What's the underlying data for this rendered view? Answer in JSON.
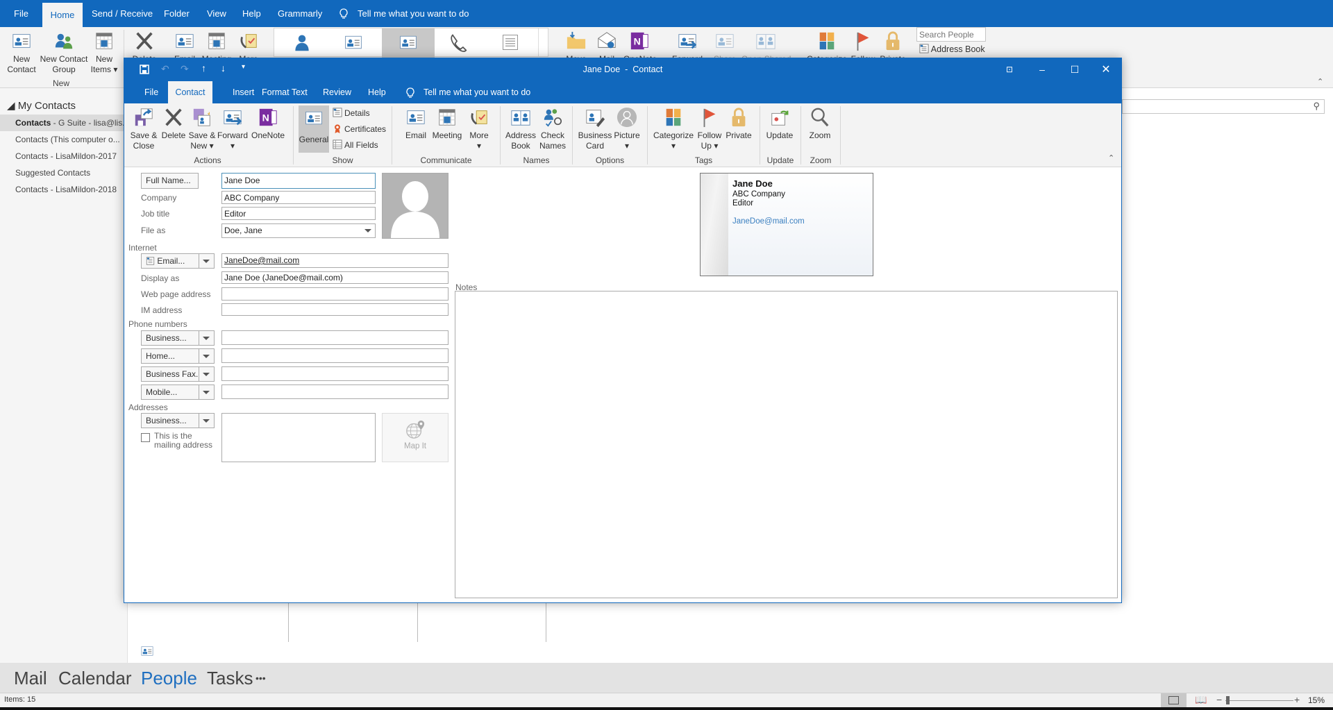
{
  "main": {
    "tabs": [
      {
        "label": "File"
      },
      {
        "label": "Home",
        "active": true
      },
      {
        "label": "Send / Receive"
      },
      {
        "label": "Folder"
      },
      {
        "label": "View"
      },
      {
        "label": "Help"
      },
      {
        "label": "Grammarly"
      }
    ],
    "tell_me": "Tell me what you want to do",
    "ribbon": {
      "new_contact": "New\nContact",
      "new_contact_group": "New Contact\nGroup",
      "new_items": "New\nItems ▾",
      "group_new": "New",
      "delete": "Delete",
      "email": "Email",
      "meeting": "Meeting",
      "more": "More",
      "move": "Move",
      "mail": "Mail",
      "onenote": "OneNote",
      "forward": "Forward",
      "share": "Share",
      "open_shared": "Open Shared",
      "categorize": "Categorize",
      "follow": "Follow",
      "private": "Private",
      "search_people_placeholder": "Search People",
      "address_book": "Address Book"
    },
    "accent_color": "#1168bd"
  },
  "sidebar": {
    "header": "My Contacts",
    "items": [
      {
        "bold": "Contacts",
        "rest": " - G Suite - lisa@lis...",
        "selected": true
      },
      {
        "bold": "",
        "rest": "Contacts (This computer o..."
      },
      {
        "bold": "",
        "rest": "Contacts - LisaMildon-2017"
      },
      {
        "bold": "",
        "rest": "Suggested Contacts"
      },
      {
        "bold": "",
        "rest": "Contacts - LisaMildon-2018"
      }
    ]
  },
  "nav": {
    "items": [
      "Mail",
      "Calendar",
      "People",
      "Tasks"
    ],
    "active": "People",
    "more": "•••"
  },
  "status": {
    "items": "Items: 15",
    "zoom": "15%",
    "zoom_value": 15
  },
  "window": {
    "title": "Jane Doe  -  Contact",
    "tabs": [
      {
        "label": "File"
      },
      {
        "label": "Contact",
        "active": true
      },
      {
        "label": "Insert"
      },
      {
        "label": "Format Text"
      },
      {
        "label": "Review"
      },
      {
        "label": "Help"
      }
    ],
    "tell_me": "Tell me what you want to do",
    "ribbon": {
      "save_close": "Save &\nClose",
      "delete": "Delete",
      "save_new": "Save &\nNew ▾",
      "forward": "Forward\n▾",
      "onenote": "OneNote",
      "general": "General",
      "details": "Details",
      "certificates": "Certificates",
      "all_fields": "All Fields",
      "email": "Email",
      "meeting": "Meeting",
      "more": "More\n▾",
      "address_book": "Address\nBook",
      "check_names": "Check\nNames",
      "business_card": "Business\nCard",
      "picture": "Picture\n▾",
      "categorize": "Categorize\n▾",
      "follow_up": "Follow\nUp ▾",
      "private": "Private",
      "update": "Update",
      "zoom": "Zoom",
      "groups": {
        "actions": "Actions",
        "show": "Show",
        "communicate": "Communicate",
        "names": "Names",
        "options": "Options",
        "tags": "Tags",
        "update": "Update",
        "zoom": "Zoom"
      }
    },
    "form": {
      "full_name_button": "Full Name...",
      "full_name": "Jane Doe",
      "company_label": "Company",
      "company": "ABC Company",
      "job_title_label": "Job title",
      "job_title": "Editor",
      "file_as_label": "File as",
      "file_as": "Doe, Jane",
      "internet_label": "Internet",
      "email_button": "Email...",
      "email": "JaneDoe@mail.com",
      "display_as_label": "Display as",
      "display_as": "Jane Doe (JaneDoe@mail.com)",
      "web_label": "Web page address",
      "web": "",
      "im_label": "IM address",
      "im": "",
      "phone_label": "Phone numbers",
      "phones": [
        {
          "type": "Business...",
          "value": ""
        },
        {
          "type": "Home...",
          "value": ""
        },
        {
          "type": "Business Fax..",
          "value": ""
        },
        {
          "type": "Mobile...",
          "value": ""
        }
      ],
      "addresses_label": "Addresses",
      "address_type": "Business...",
      "address": "",
      "mailing_checkbox": "This is the\nmailing address",
      "mailing_checked": false,
      "map_it": "Map It",
      "notes_label": "Notes",
      "notes": ""
    },
    "card": {
      "name": "Jane Doe",
      "company": "ABC Company",
      "title": "Editor",
      "email": "JaneDoe@mail.com"
    }
  }
}
